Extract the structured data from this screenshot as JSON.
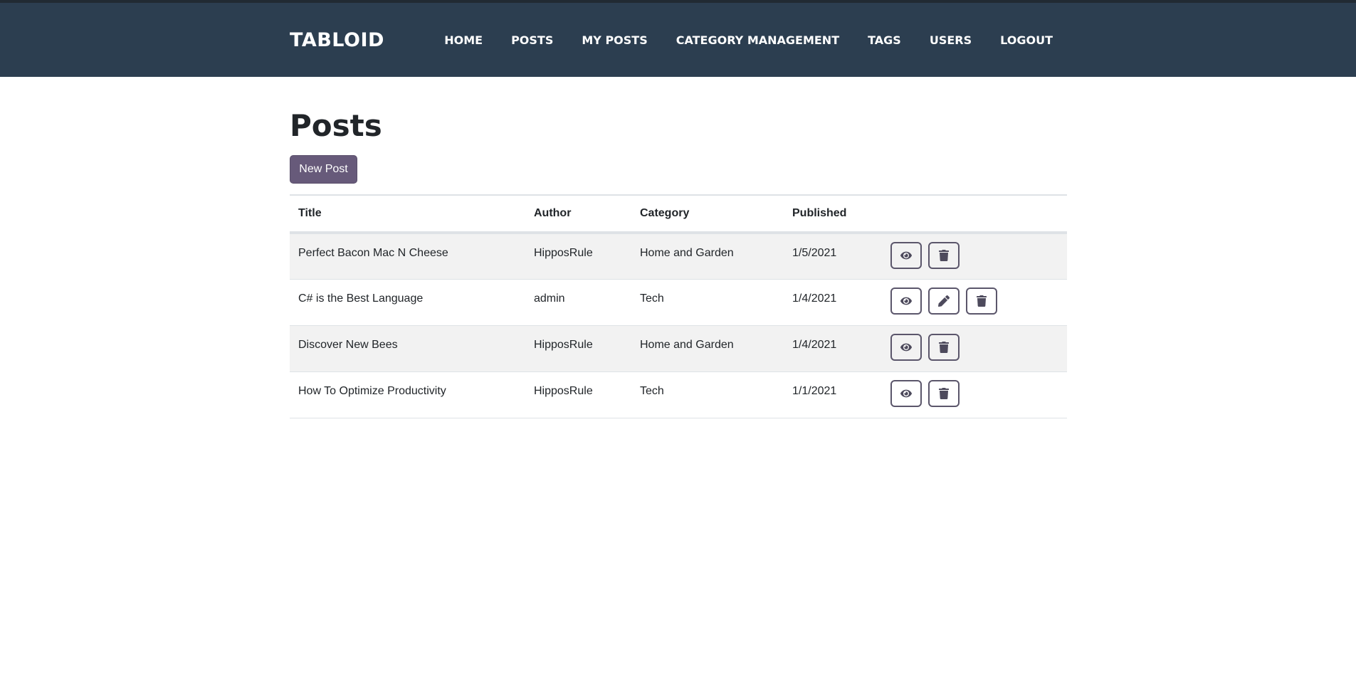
{
  "nav": {
    "brand": "TABLOID",
    "links": [
      "HOME",
      "POSTS",
      "MY POSTS",
      "CATEGORY MANAGEMENT",
      "TAGS",
      "USERS",
      "LOGOUT"
    ]
  },
  "page": {
    "title": "Posts",
    "new_post_label": "New Post"
  },
  "table": {
    "headers": [
      "Title",
      "Author",
      "Category",
      "Published"
    ],
    "rows": [
      {
        "title": "Perfect Bacon Mac N Cheese",
        "author": "HipposRule",
        "category": "Home and Garden",
        "published": "1/5/2021",
        "actions": [
          "eye-icon",
          "trash-icon"
        ]
      },
      {
        "title": "C# is the Best Language",
        "author": "admin",
        "category": "Tech",
        "published": "1/4/2021",
        "actions": [
          "eye-icon",
          "pencil-icon",
          "trash-icon"
        ]
      },
      {
        "title": "Discover New Bees",
        "author": "HipposRule",
        "category": "Home and Garden",
        "published": "1/4/2021",
        "actions": [
          "eye-icon",
          "trash-icon"
        ]
      },
      {
        "title": "How To Optimize Productivity",
        "author": "HipposRule",
        "category": "Tech",
        "published": "1/1/2021",
        "actions": [
          "eye-icon",
          "trash-icon"
        ]
      }
    ]
  },
  "colors": {
    "navbar": "#2c3e50",
    "button": "#675a7a",
    "stripe": "#f2f2f2"
  }
}
